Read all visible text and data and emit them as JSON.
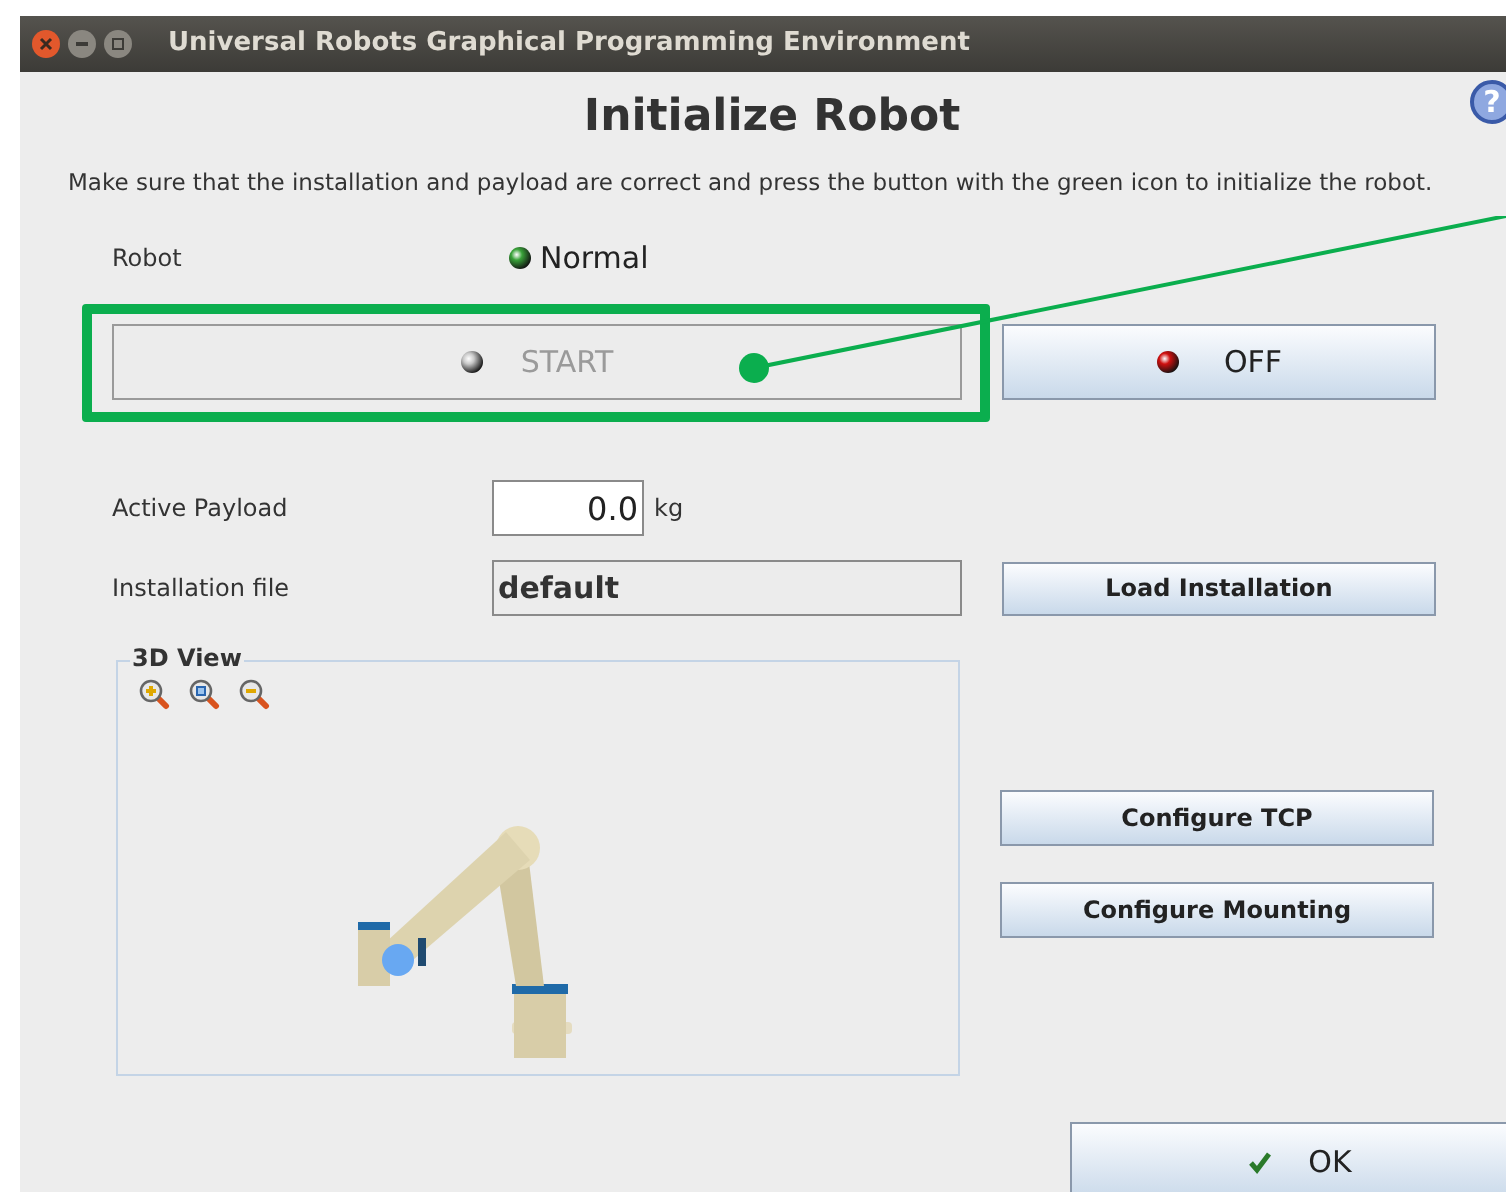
{
  "window": {
    "title": "Universal Robots Graphical Programming Environment"
  },
  "help_button": "?",
  "heading": "Initialize Robot",
  "instruction": "Make sure that the installation and payload are correct and press the button with the green icon to initialize the robot.",
  "robot": {
    "label": "Robot",
    "status": "Normal",
    "ok": true
  },
  "start_button": {
    "label": "START",
    "disabled": true,
    "highlighted": true
  },
  "power_button": {
    "label": "OFF",
    "on": false
  },
  "payload": {
    "label": "Active Payload",
    "value": "0.0",
    "unit": "kg"
  },
  "installation": {
    "label": "Installation file",
    "value": "default",
    "button": "Load Installation"
  },
  "view_3d": {
    "title": "3D View"
  },
  "side_buttons": [
    "Configure TCP",
    "Configure Mounting"
  ],
  "ok_button": "OK"
}
